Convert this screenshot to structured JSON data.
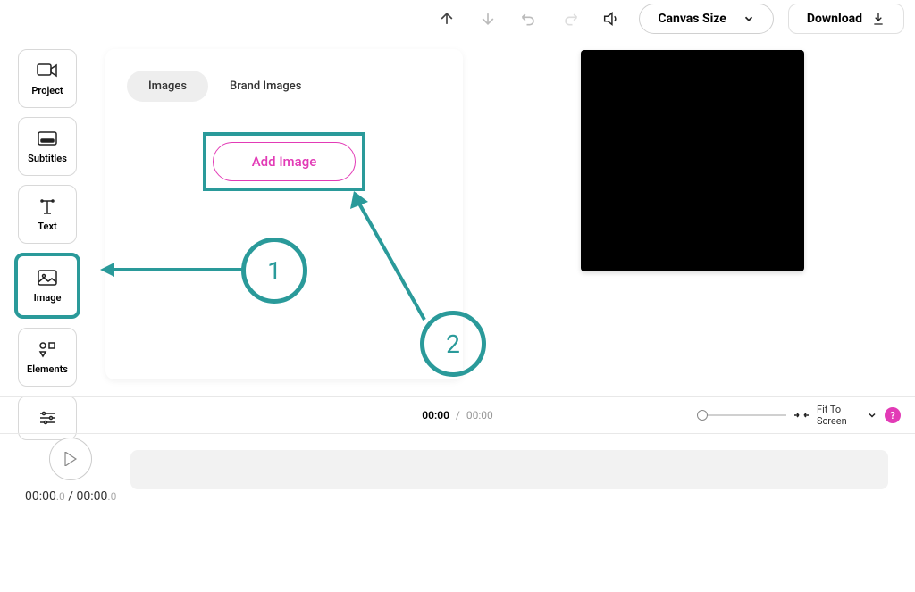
{
  "toolbar": {
    "canvas_size_label": "Canvas Size",
    "download_label": "Download"
  },
  "sidebar": {
    "items": [
      {
        "label": "Project"
      },
      {
        "label": "Subtitles"
      },
      {
        "label": "Text"
      },
      {
        "label": "Image"
      },
      {
        "label": "Elements"
      }
    ]
  },
  "panel": {
    "tabs": [
      {
        "label": "Images"
      },
      {
        "label": "Brand Images"
      }
    ],
    "add_image_label": "Add Image"
  },
  "annotations": {
    "step1": "1",
    "step2": "2"
  },
  "timeline": {
    "current": "00:00",
    "separator": "/",
    "total": "00:00",
    "fit_label": "Fit To Screen",
    "help": "?"
  },
  "playback": {
    "current": "00:00",
    "current_dec": ".0",
    "sep": " / ",
    "total": "00:00",
    "total_dec": ".0"
  }
}
